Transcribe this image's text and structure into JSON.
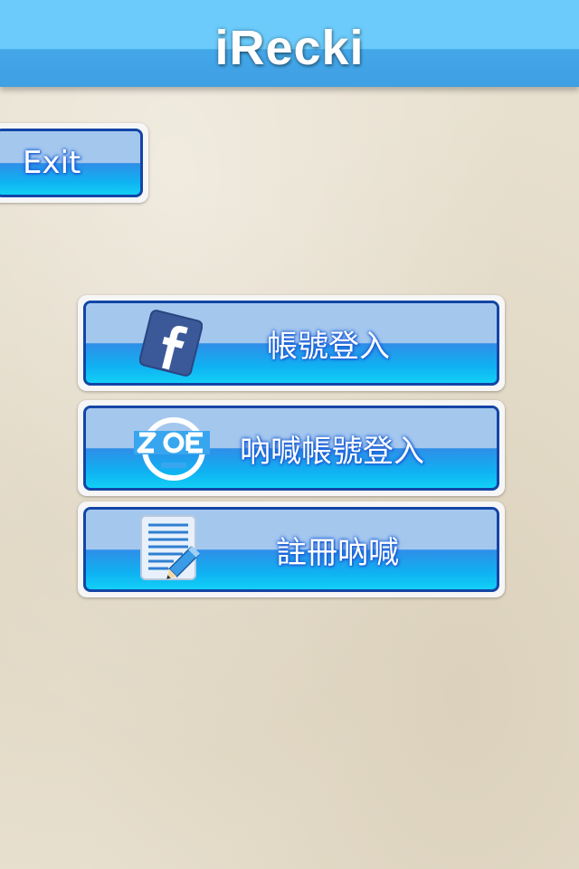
{
  "header": {
    "title": "iRecki"
  },
  "exit_button": {
    "label": "Exit"
  },
  "menu": {
    "buttons": [
      {
        "label": "帳號登入",
        "icon": "facebook-icon",
        "icon_color": "#3b5998"
      },
      {
        "label": "吶喊帳號登入",
        "icon": "wow-face-icon"
      },
      {
        "label": "註冊吶喊",
        "icon": "notepad-pencil-icon"
      }
    ]
  },
  "colors": {
    "header_top": "#6ccbfb",
    "header_bottom": "#3f9fe3",
    "button_border": "#1345a6",
    "button_glow": "#1a5fd6",
    "background": "#e8e0cf"
  }
}
